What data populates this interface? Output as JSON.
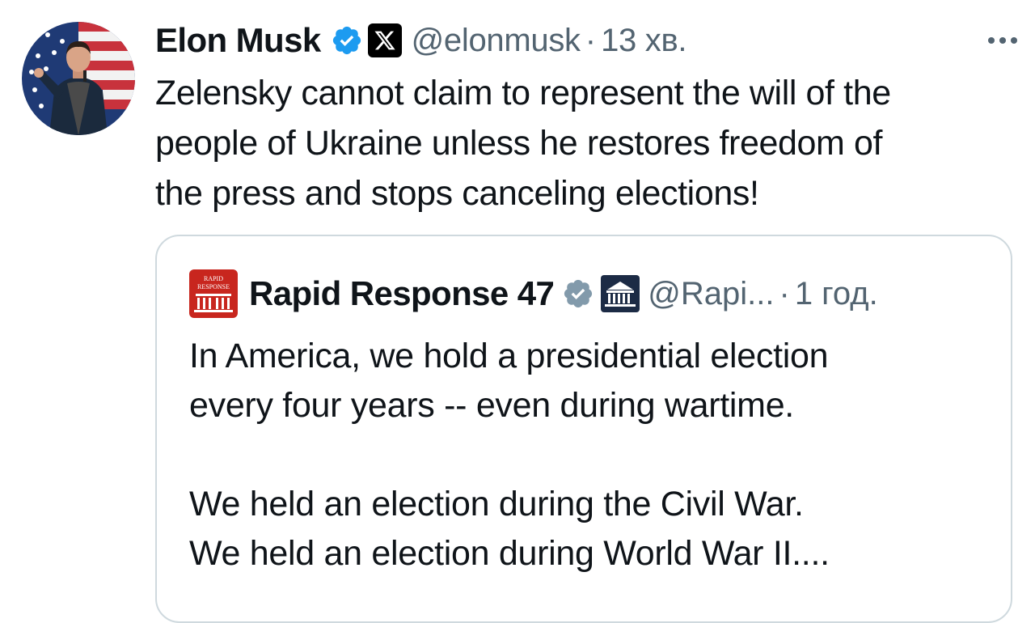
{
  "tweet": {
    "author_name": "Elon Musk",
    "handle": "@elonmusk",
    "separator": "·",
    "time": "13 хв.",
    "lines": [
      "Zelensky cannot claim to represent the will of the",
      "people of Ukraine unless he restores freedom of",
      "the press and stops canceling elections!"
    ],
    "icons": {
      "verified": "verified-badge-icon",
      "affiliation": "x-logo-icon",
      "more": "more-dots-icon"
    },
    "colors": {
      "verified": "#1d9bf0",
      "secondary_text": "#536471"
    }
  },
  "quote": {
    "author_name": "Rapid Response 47",
    "handle": "@Rapi...",
    "separator": "·",
    "time": "1 год.",
    "logo_text": [
      "RAPID",
      "RESPONSE"
    ],
    "paragraph_1": [
      "In America, we hold a presidential election",
      "every four years -- even during wartime."
    ],
    "paragraph_2": [
      "We held an election during the Civil War.",
      "We held an election during World War II...."
    ],
    "icons": {
      "verified": "gray-verified-badge-icon",
      "affiliation": "white-house-icon"
    },
    "colors": {
      "verified": "#829aab",
      "logo_bg": "#c8261e"
    }
  }
}
